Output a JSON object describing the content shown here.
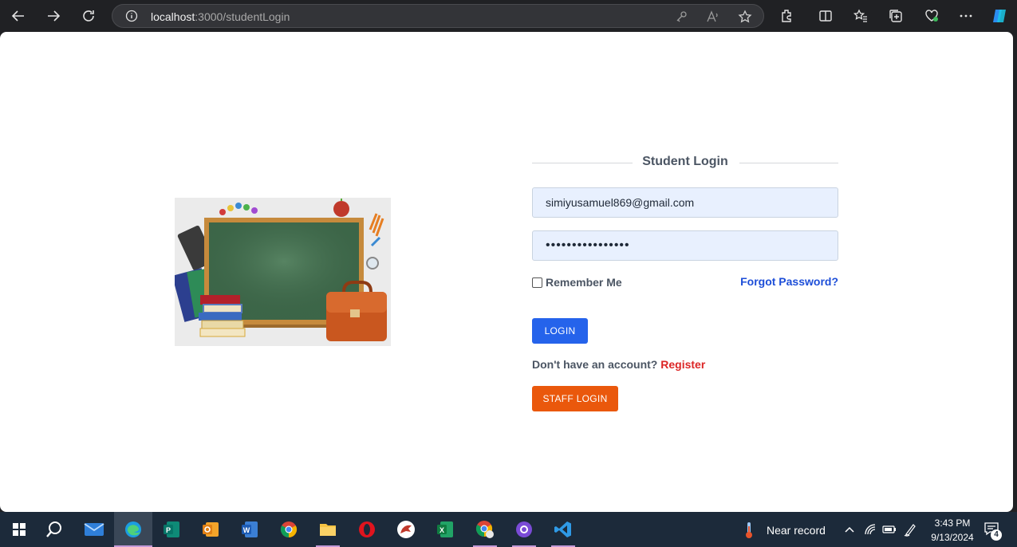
{
  "browser": {
    "url_host": "localhost",
    "url_path": ":3000/studentLogin"
  },
  "login": {
    "title": "Student Login",
    "email_value": "simiyusamuel869@gmail.com",
    "password_value": "••••••••••••••••",
    "remember_label": "Remember Me",
    "remember_checked": false,
    "forgot_label": "Forgot Password?",
    "login_label": "LOGIN",
    "register_prompt": "Don't have an account?",
    "register_label": "Register",
    "staff_login_label": "STAFF LOGIN"
  },
  "colors": {
    "primary": "#2563eb",
    "staff": "#ea580c",
    "register": "#dc2626",
    "forgot": "#1d4ed8"
  },
  "taskbar": {
    "weather_label": "Near record",
    "time": "3:43 PM",
    "date": "9/13/2024",
    "notification_count": "4",
    "apps": [
      "start-icon",
      "search-icon",
      "mail-icon",
      "edge-icon",
      "publisher-icon",
      "outlook-icon",
      "word-icon",
      "chrome-icon",
      "file-explorer-icon",
      "opera-icon",
      "lion-app-icon",
      "excel-icon",
      "chrome-profile-icon",
      "github-icon",
      "vscode-icon"
    ]
  }
}
